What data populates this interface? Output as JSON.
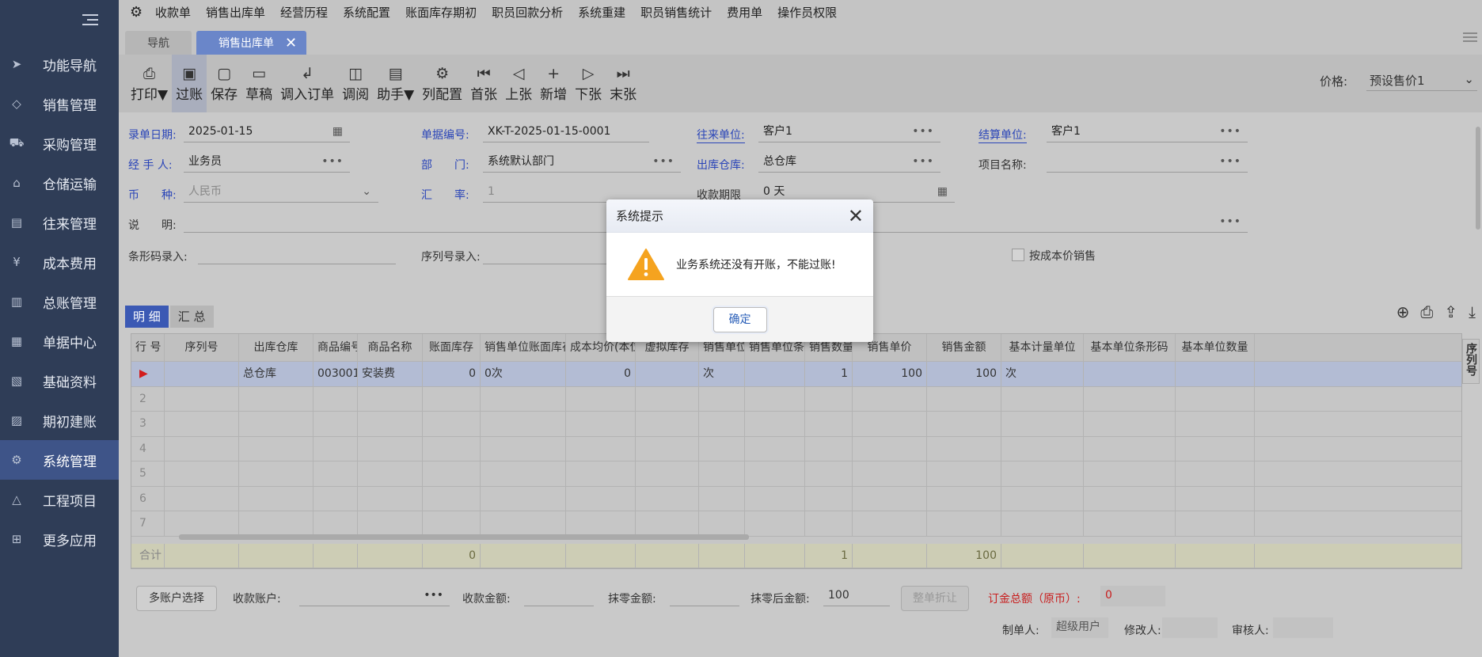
{
  "sidebar": {
    "items": [
      {
        "label": "功能导航",
        "icon": "send-icon",
        "glyph": "➤"
      },
      {
        "label": "销售管理",
        "icon": "tag-icon",
        "glyph": "◇"
      },
      {
        "label": "采购管理",
        "icon": "cart-icon",
        "glyph": "⛟"
      },
      {
        "label": "仓储运输",
        "icon": "warehouse-icon",
        "glyph": "⌂"
      },
      {
        "label": "往来管理",
        "icon": "ledger-icon",
        "glyph": "▤"
      },
      {
        "label": "成本费用",
        "icon": "yen-icon",
        "glyph": "¥"
      },
      {
        "label": "总账管理",
        "icon": "chart-icon",
        "glyph": "▥"
      },
      {
        "label": "单据中心",
        "icon": "document-icon",
        "glyph": "▦"
      },
      {
        "label": "基础资料",
        "icon": "search-doc-icon",
        "glyph": "▧"
      },
      {
        "label": "期初建账",
        "icon": "book-icon",
        "glyph": "▨"
      },
      {
        "label": "系统管理",
        "icon": "gear-icon",
        "glyph": "⚙"
      },
      {
        "label": "工程项目",
        "icon": "warning-icon",
        "glyph": "△"
      },
      {
        "label": "更多应用",
        "icon": "grid-icon",
        "glyph": "⊞"
      }
    ],
    "active_index": 10
  },
  "topmenu": [
    "收款单",
    "销售出库单",
    "经营历程",
    "系统配置",
    "账面库存期初",
    "职员回款分析",
    "系统重建",
    "职员销售统计",
    "费用单",
    "操作员权限"
  ],
  "tabs": {
    "nav": "导航",
    "active": "销售出库单"
  },
  "toolbar": {
    "buttons": [
      {
        "label": "打印▼",
        "icon": "printer-icon",
        "glyph": "⎙"
      },
      {
        "label": "过账",
        "icon": "post-icon",
        "glyph": "▣"
      },
      {
        "label": "保存",
        "icon": "save-icon",
        "glyph": "▢"
      },
      {
        "label": "草稿",
        "icon": "draft-icon",
        "glyph": "▭"
      },
      {
        "label": "调入订单",
        "icon": "import-icon",
        "glyph": "↲"
      },
      {
        "label": "调阅",
        "icon": "view-icon",
        "glyph": "◫"
      },
      {
        "label": "助手▼",
        "icon": "clipboard-icon",
        "glyph": "▤"
      },
      {
        "label": "列配置",
        "icon": "settings-icon",
        "glyph": "⚙"
      },
      {
        "label": "首张",
        "icon": "first-icon",
        "glyph": "⏮"
      },
      {
        "label": "上张",
        "icon": "prev-icon",
        "glyph": "◁"
      },
      {
        "label": "新增",
        "icon": "plus-icon",
        "glyph": "+"
      },
      {
        "label": "下张",
        "icon": "next-icon",
        "glyph": "▷"
      },
      {
        "label": "末张",
        "icon": "last-icon",
        "glyph": "⏭"
      }
    ],
    "price_label": "价格:",
    "price_value": "预设售价1"
  },
  "form": {
    "date_label": "录单日期:",
    "date_value": "2025-01-15",
    "no_label": "单据编号:",
    "no_value": "XK-T-2025-01-15-0001",
    "partner_label": "往来单位:",
    "partner_value": "客户1",
    "settle_label": "结算单位:",
    "settle_value": "客户1",
    "handler_label": "经 手 人:",
    "handler_value": "业务员",
    "dept_label": "部　　门:",
    "dept_value": "系统默认部门",
    "wh_label": "出库仓库:",
    "wh_value": "总仓库",
    "project_label": "项目名称:",
    "currency_label": "币　　种:",
    "currency_value": "人民币",
    "rate_label": "汇　　率:",
    "rate_value": "1",
    "due_label": "收款期限",
    "due_value": "0 天",
    "note_label": "说　　明:",
    "barcode_label": "条形码录入:",
    "serial_label": "序列号录入:",
    "cost_label": "按成本价销售",
    "dots": "•••"
  },
  "grid_tabs": [
    "明 细",
    "汇 总"
  ],
  "grid": {
    "columns": [
      "行 号",
      "序列号",
      "出库仓库",
      "商品编号",
      "商品名称",
      "账面库存",
      "销售单位账面库存",
      "成本均价(本位",
      "虚拟库存",
      "销售单位",
      "销售单位条形",
      "销售数量",
      "销售单价",
      "销售金额",
      "基本计量单位",
      "基本单位条形码",
      "基本单位数量"
    ],
    "rows": [
      [
        "▶",
        "",
        "总仓库",
        "003001",
        "安装费",
        "0",
        "0次",
        "0",
        "",
        "次",
        "",
        "1",
        "100",
        "100",
        "次",
        "",
        ""
      ],
      [
        "2",
        "",
        "",
        "",
        "",
        "",
        "",
        "",
        "",
        "",
        "",
        "",
        "",
        "",
        "",
        "",
        ""
      ],
      [
        "3",
        "",
        "",
        "",
        "",
        "",
        "",
        "",
        "",
        "",
        "",
        "",
        "",
        "",
        "",
        "",
        ""
      ],
      [
        "4",
        "",
        "",
        "",
        "",
        "",
        "",
        "",
        "",
        "",
        "",
        "",
        "",
        "",
        "",
        "",
        ""
      ],
      [
        "5",
        "",
        "",
        "",
        "",
        "",
        "",
        "",
        "",
        "",
        "",
        "",
        "",
        "",
        "",
        "",
        ""
      ],
      [
        "6",
        "",
        "",
        "",
        "",
        "",
        "",
        "",
        "",
        "",
        "",
        "",
        "",
        "",
        "",
        "",
        ""
      ],
      [
        "7",
        "",
        "",
        "",
        "",
        "",
        "",
        "",
        "",
        "",
        "",
        "",
        "",
        "",
        "",
        "",
        ""
      ]
    ],
    "sum": [
      "合计",
      "",
      "",
      "",
      "",
      "0",
      "",
      "",
      "",
      "",
      "",
      "1",
      "",
      "100",
      "",
      "",
      ""
    ],
    "side_tab": "序列号"
  },
  "bottom": {
    "multi_btn": "多账户选择",
    "account_label": "收款账户:",
    "amount_label": "收款金额:",
    "erase_label": "抹零金额:",
    "after_label": "抹零后金额:",
    "after_value": "100",
    "discount_btn": "整单折让",
    "total_label": "订金总额（原币）:",
    "total_value": "0",
    "maker_label": "制单人:",
    "maker_value": "超级用户",
    "modifier_label": "修改人:",
    "auditor_label": "审核人:"
  },
  "modal": {
    "title": "系统提示",
    "message": "业务系统还没有开账，不能过账!",
    "ok": "确定"
  }
}
